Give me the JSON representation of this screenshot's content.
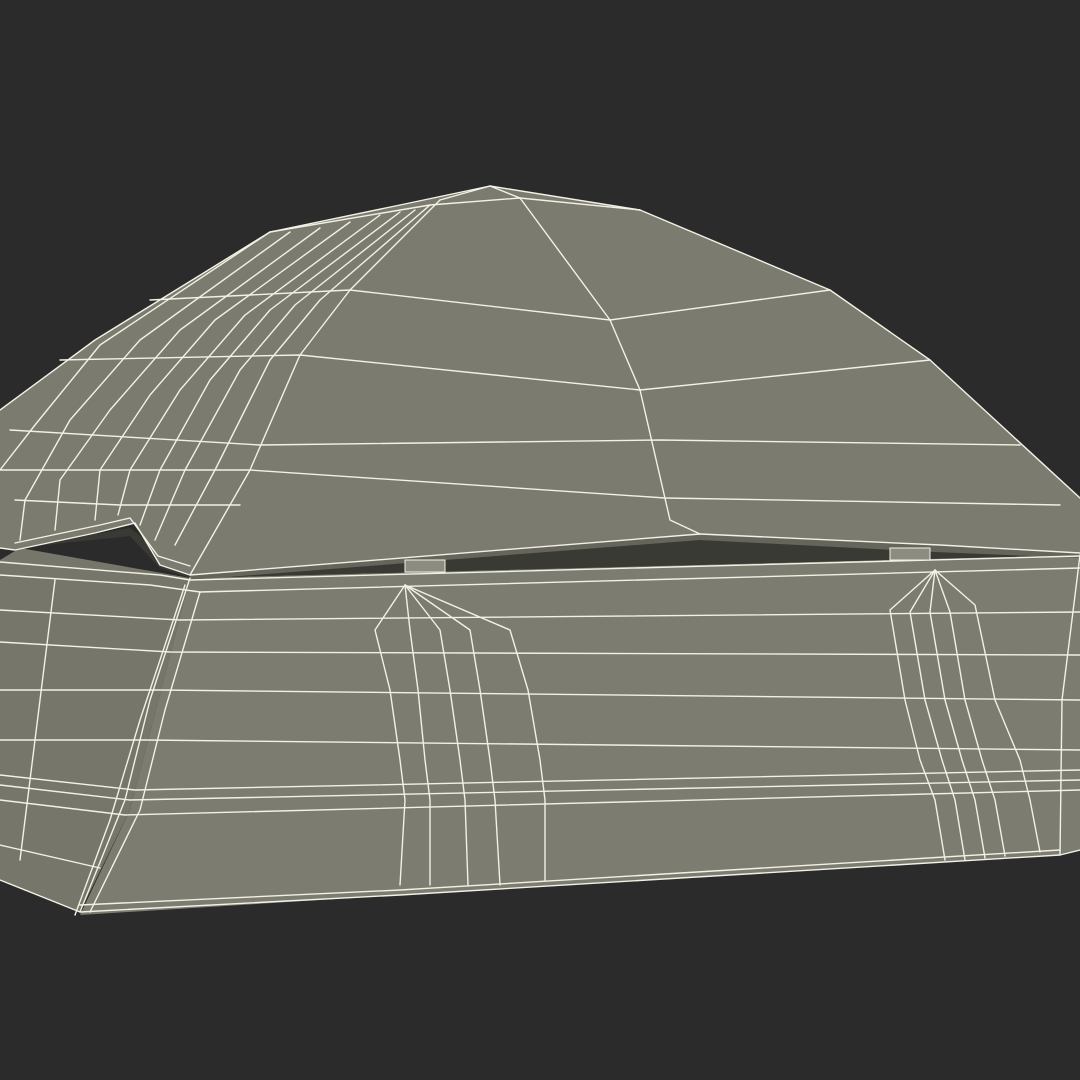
{
  "scene": {
    "subject": "tent-wireframe-render",
    "background_color": "#2b2b2b",
    "surface_color": "#7b7b70",
    "surface_shadow_color": "#65655c",
    "inner_shadow_color": "#3a3a35",
    "wire_color": "#f3f1e6",
    "edge_highlight_color": "#d9d7cc"
  }
}
